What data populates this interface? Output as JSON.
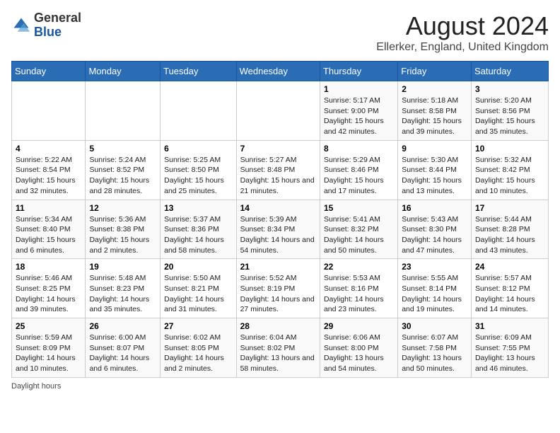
{
  "header": {
    "logo_general": "General",
    "logo_blue": "Blue",
    "month_year": "August 2024",
    "location": "Ellerker, England, United Kingdom"
  },
  "days_of_week": [
    "Sunday",
    "Monday",
    "Tuesday",
    "Wednesday",
    "Thursday",
    "Friday",
    "Saturday"
  ],
  "weeks": [
    [
      {
        "day": "",
        "info": ""
      },
      {
        "day": "",
        "info": ""
      },
      {
        "day": "",
        "info": ""
      },
      {
        "day": "",
        "info": ""
      },
      {
        "day": "1",
        "info": "Sunrise: 5:17 AM\nSunset: 9:00 PM\nDaylight: 15 hours and 42 minutes."
      },
      {
        "day": "2",
        "info": "Sunrise: 5:18 AM\nSunset: 8:58 PM\nDaylight: 15 hours and 39 minutes."
      },
      {
        "day": "3",
        "info": "Sunrise: 5:20 AM\nSunset: 8:56 PM\nDaylight: 15 hours and 35 minutes."
      }
    ],
    [
      {
        "day": "4",
        "info": "Sunrise: 5:22 AM\nSunset: 8:54 PM\nDaylight: 15 hours and 32 minutes."
      },
      {
        "day": "5",
        "info": "Sunrise: 5:24 AM\nSunset: 8:52 PM\nDaylight: 15 hours and 28 minutes."
      },
      {
        "day": "6",
        "info": "Sunrise: 5:25 AM\nSunset: 8:50 PM\nDaylight: 15 hours and 25 minutes."
      },
      {
        "day": "7",
        "info": "Sunrise: 5:27 AM\nSunset: 8:48 PM\nDaylight: 15 hours and 21 minutes."
      },
      {
        "day": "8",
        "info": "Sunrise: 5:29 AM\nSunset: 8:46 PM\nDaylight: 15 hours and 17 minutes."
      },
      {
        "day": "9",
        "info": "Sunrise: 5:30 AM\nSunset: 8:44 PM\nDaylight: 15 hours and 13 minutes."
      },
      {
        "day": "10",
        "info": "Sunrise: 5:32 AM\nSunset: 8:42 PM\nDaylight: 15 hours and 10 minutes."
      }
    ],
    [
      {
        "day": "11",
        "info": "Sunrise: 5:34 AM\nSunset: 8:40 PM\nDaylight: 15 hours and 6 minutes."
      },
      {
        "day": "12",
        "info": "Sunrise: 5:36 AM\nSunset: 8:38 PM\nDaylight: 15 hours and 2 minutes."
      },
      {
        "day": "13",
        "info": "Sunrise: 5:37 AM\nSunset: 8:36 PM\nDaylight: 14 hours and 58 minutes."
      },
      {
        "day": "14",
        "info": "Sunrise: 5:39 AM\nSunset: 8:34 PM\nDaylight: 14 hours and 54 minutes."
      },
      {
        "day": "15",
        "info": "Sunrise: 5:41 AM\nSunset: 8:32 PM\nDaylight: 14 hours and 50 minutes."
      },
      {
        "day": "16",
        "info": "Sunrise: 5:43 AM\nSunset: 8:30 PM\nDaylight: 14 hours and 47 minutes."
      },
      {
        "day": "17",
        "info": "Sunrise: 5:44 AM\nSunset: 8:28 PM\nDaylight: 14 hours and 43 minutes."
      }
    ],
    [
      {
        "day": "18",
        "info": "Sunrise: 5:46 AM\nSunset: 8:25 PM\nDaylight: 14 hours and 39 minutes."
      },
      {
        "day": "19",
        "info": "Sunrise: 5:48 AM\nSunset: 8:23 PM\nDaylight: 14 hours and 35 minutes."
      },
      {
        "day": "20",
        "info": "Sunrise: 5:50 AM\nSunset: 8:21 PM\nDaylight: 14 hours and 31 minutes."
      },
      {
        "day": "21",
        "info": "Sunrise: 5:52 AM\nSunset: 8:19 PM\nDaylight: 14 hours and 27 minutes."
      },
      {
        "day": "22",
        "info": "Sunrise: 5:53 AM\nSunset: 8:16 PM\nDaylight: 14 hours and 23 minutes."
      },
      {
        "day": "23",
        "info": "Sunrise: 5:55 AM\nSunset: 8:14 PM\nDaylight: 14 hours and 19 minutes."
      },
      {
        "day": "24",
        "info": "Sunrise: 5:57 AM\nSunset: 8:12 PM\nDaylight: 14 hours and 14 minutes."
      }
    ],
    [
      {
        "day": "25",
        "info": "Sunrise: 5:59 AM\nSunset: 8:09 PM\nDaylight: 14 hours and 10 minutes."
      },
      {
        "day": "26",
        "info": "Sunrise: 6:00 AM\nSunset: 8:07 PM\nDaylight: 14 hours and 6 minutes."
      },
      {
        "day": "27",
        "info": "Sunrise: 6:02 AM\nSunset: 8:05 PM\nDaylight: 14 hours and 2 minutes."
      },
      {
        "day": "28",
        "info": "Sunrise: 6:04 AM\nSunset: 8:02 PM\nDaylight: 13 hours and 58 minutes."
      },
      {
        "day": "29",
        "info": "Sunrise: 6:06 AM\nSunset: 8:00 PM\nDaylight: 13 hours and 54 minutes."
      },
      {
        "day": "30",
        "info": "Sunrise: 6:07 AM\nSunset: 7:58 PM\nDaylight: 13 hours and 50 minutes."
      },
      {
        "day": "31",
        "info": "Sunrise: 6:09 AM\nSunset: 7:55 PM\nDaylight: 13 hours and 46 minutes."
      }
    ]
  ],
  "footer": {
    "daylight_label": "Daylight hours"
  }
}
